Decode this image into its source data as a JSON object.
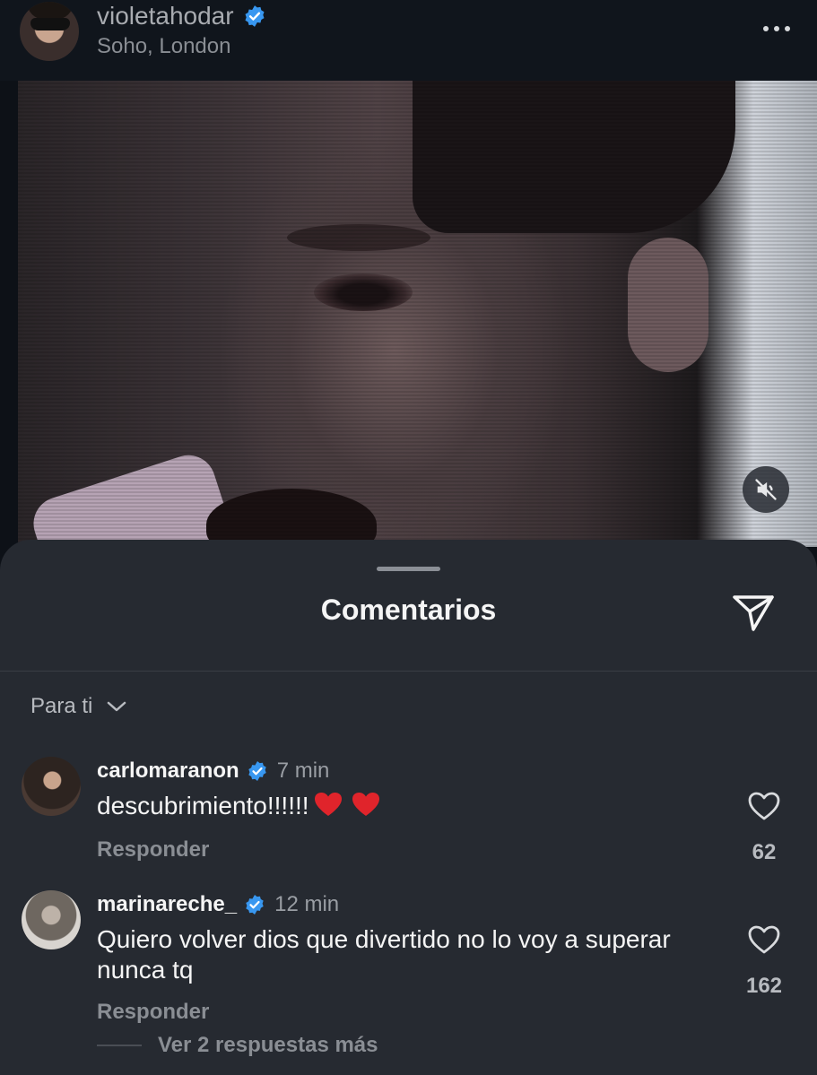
{
  "post": {
    "username": "violetahodar",
    "location": "Soho, London",
    "verified": true
  },
  "comments_sheet": {
    "title": "Comentarios",
    "filter_label": "Para ti",
    "comments": [
      {
        "username": "carlomaranon",
        "verified": true,
        "time": "7 min",
        "text": "descubrimiento!!!!!!",
        "emojis": [
          "heart-emoji",
          "heart-emoji"
        ],
        "reply_label": "Responder",
        "likes": "62"
      },
      {
        "username": "marinareche_",
        "verified": true,
        "time": "12 min",
        "text": "Quiero volver dios que divertido no lo voy a superar nunca tq",
        "reply_label": "Responder",
        "likes": "162"
      }
    ],
    "more_replies_label": "Ver 2 respuestas más"
  },
  "colors": {
    "background": "#0d1117",
    "sheet": "#262a31",
    "verified_blue": "#3897f0",
    "heart_red": "#e0242b"
  }
}
